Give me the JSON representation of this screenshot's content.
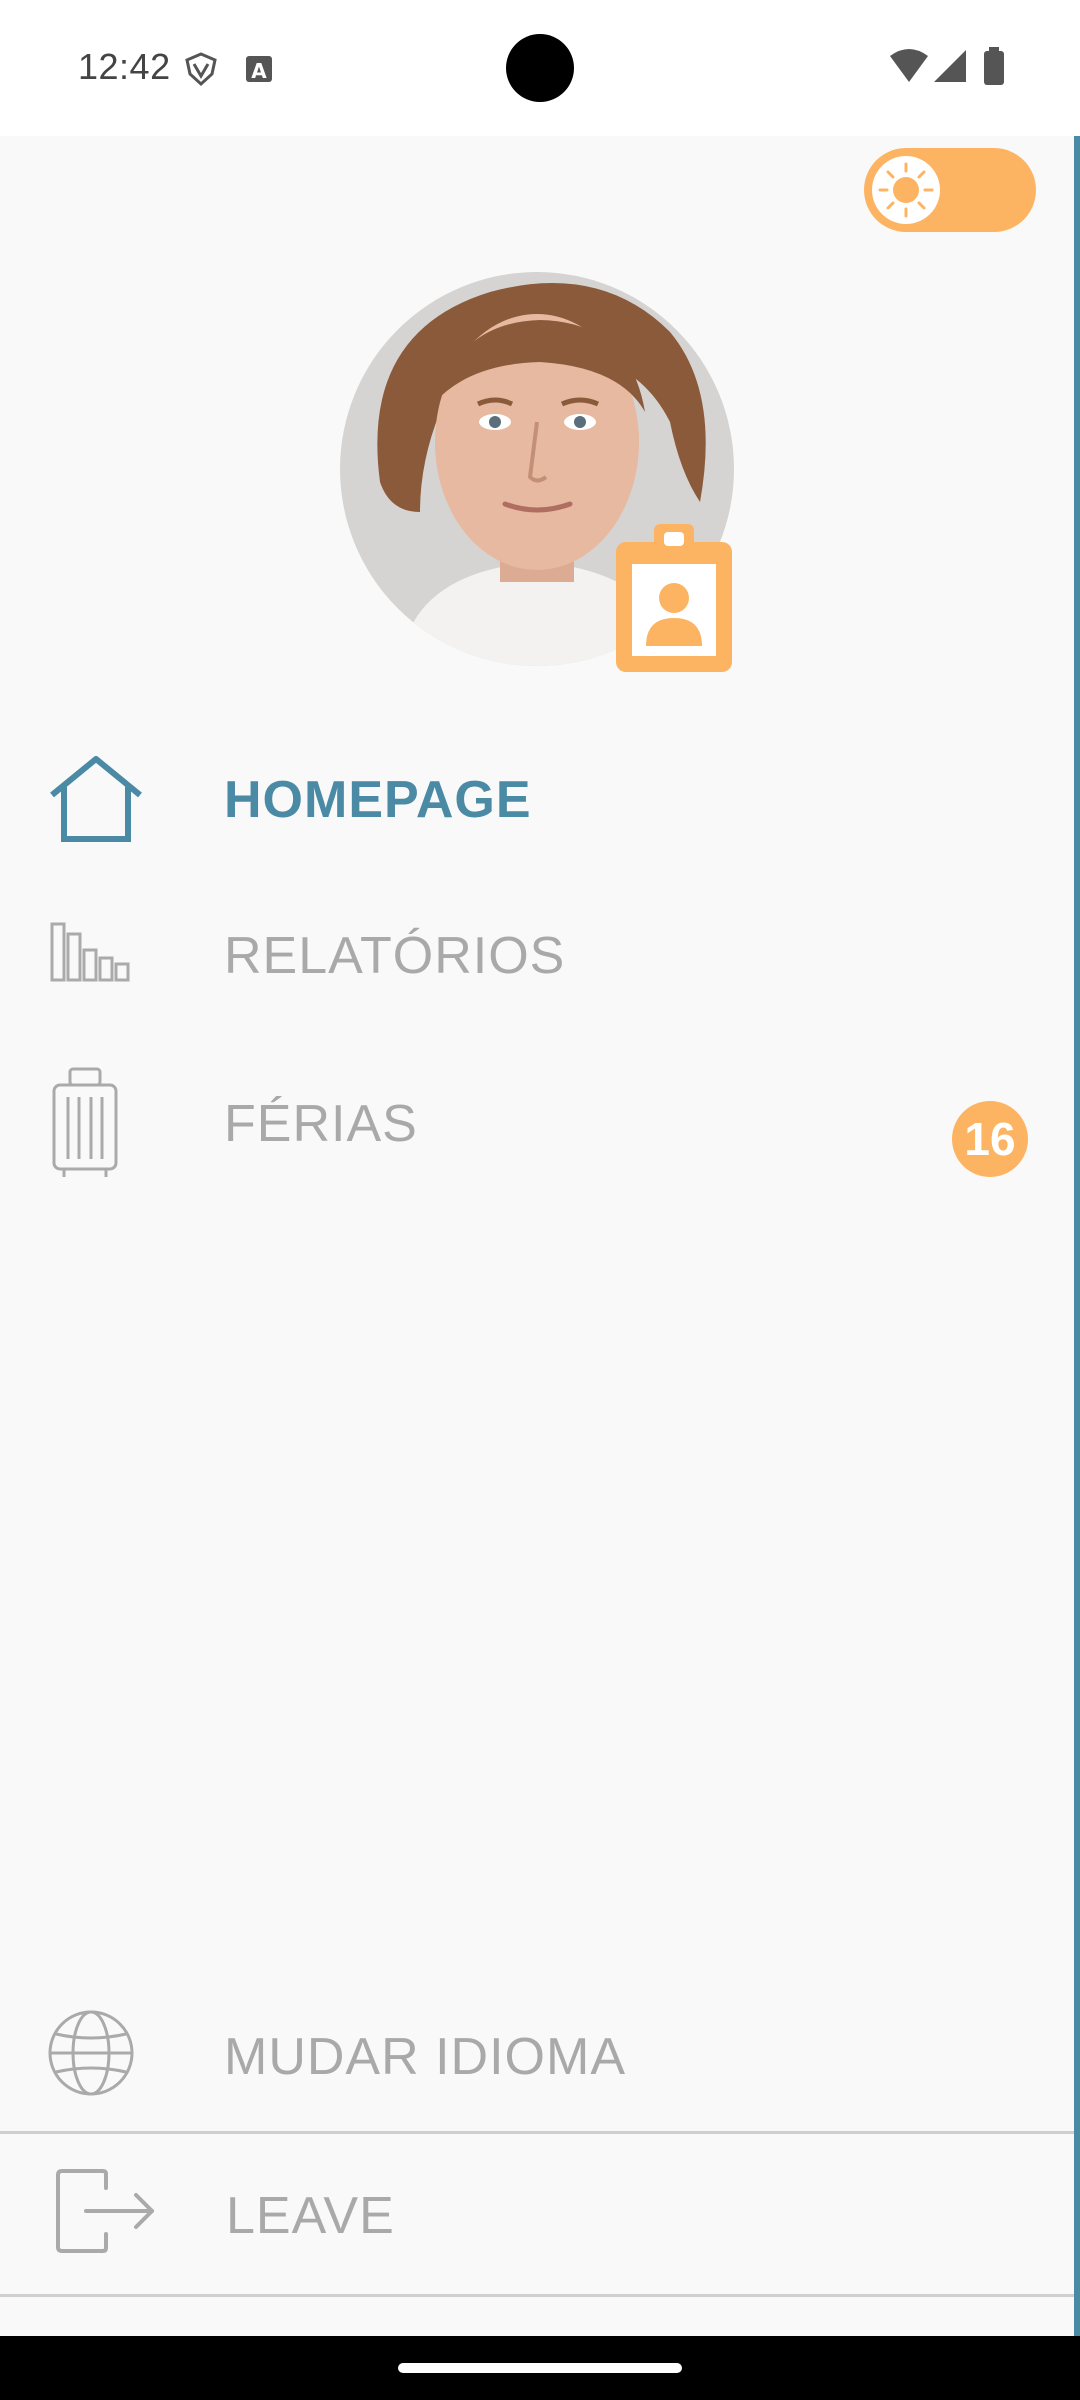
{
  "status_bar": {
    "time": "12:42",
    "icons": [
      "vpn-shield-icon",
      "app-notification-a-icon",
      "wifi-icon",
      "cellular-signal-icon",
      "battery-icon"
    ]
  },
  "theme_toggle": {
    "icon": "sun-icon",
    "state": "light"
  },
  "profile": {
    "avatar": "user-avatar-photo",
    "badge_icon": "id-badge-icon"
  },
  "nav": {
    "items": [
      {
        "label": "HOMEPAGE",
        "icon": "home-icon",
        "active": true
      },
      {
        "label": "RELATÓRIOS",
        "icon": "bar-chart-icon",
        "active": false
      },
      {
        "label": "FÉRIAS",
        "icon": "luggage-icon",
        "active": false,
        "count": "16"
      }
    ],
    "language": {
      "label": "MUDAR IDIOMA",
      "icon": "globe-icon"
    },
    "leave": {
      "label": "LEAVE",
      "icon": "logout-icon"
    }
  },
  "colors": {
    "accent": "#4a8aa5",
    "highlight": "#fdb462",
    "inactive": "#a9a9a9",
    "background": "#f9f9f9"
  }
}
